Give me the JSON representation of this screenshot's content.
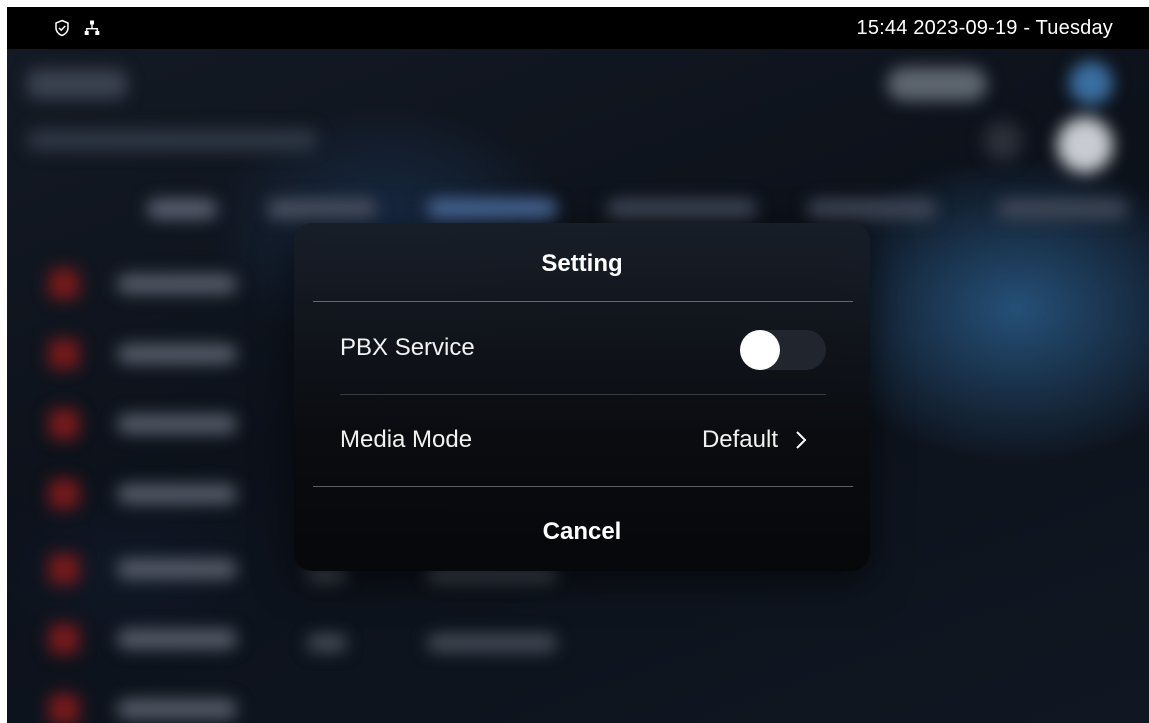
{
  "status_bar": {
    "icons": [
      "shield-check-icon",
      "network-icon"
    ],
    "datetime": "15:44  2023-09-19 - Tuesday"
  },
  "dialog": {
    "title": "Setting",
    "rows": [
      {
        "label": "PBX Service",
        "control": "toggle",
        "enabled": false
      },
      {
        "label": "Media Mode",
        "value": "Default",
        "control": "chevron-right-icon"
      }
    ],
    "cancel_label": "Cancel"
  },
  "colors": {
    "status_bar_bg": "#000000",
    "dialog_bg": "#0c0f15",
    "toggle_track": "#20252e",
    "toggle_knob": "#ffffff",
    "text": "#ffffff"
  }
}
